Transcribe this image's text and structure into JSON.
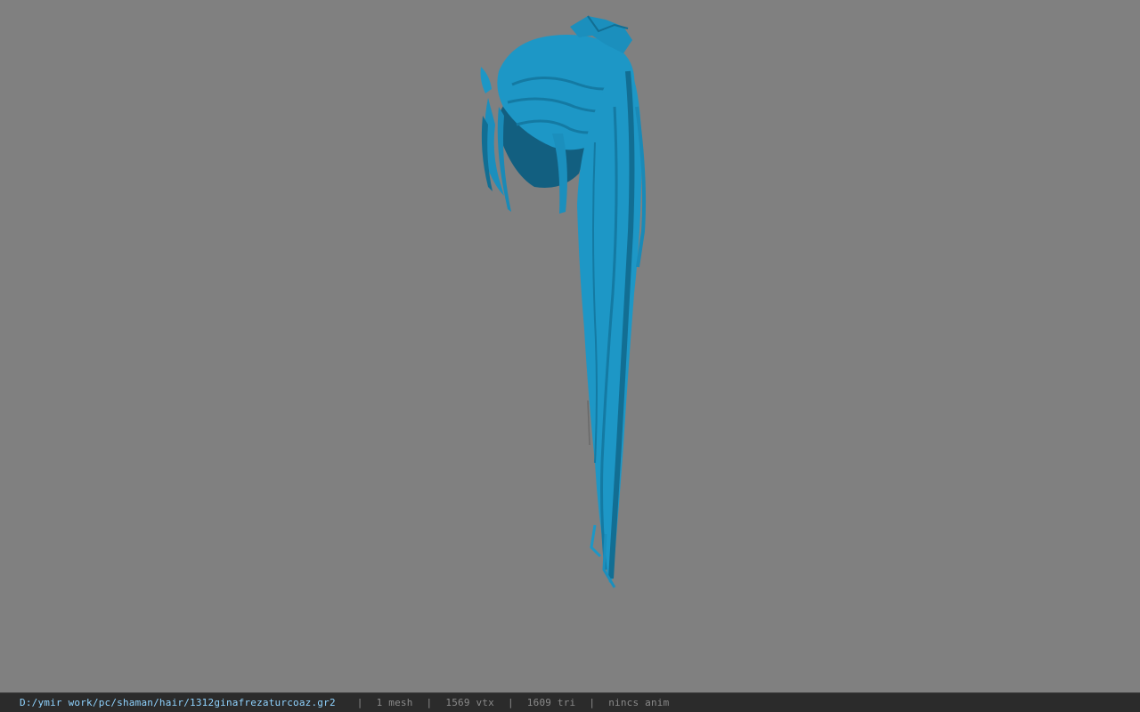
{
  "viewport": {
    "background": "#808080",
    "model_icon": "hair-ponytail-mesh-icon",
    "model_color": "#1e9fd0"
  },
  "statusbar": {
    "file_path": "D:/ymir work/pc/shaman/hair/1312ginafrezaturcoaz.gr2",
    "separator": "|",
    "mesh": "1 mesh",
    "vertices": "1569 vtx",
    "triangles": "1609 tri",
    "anim": "nincs anim"
  }
}
